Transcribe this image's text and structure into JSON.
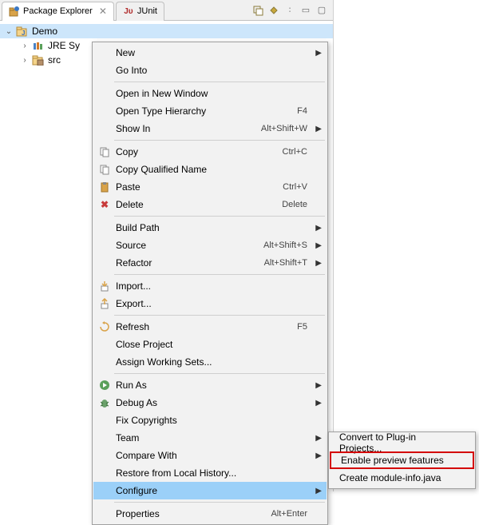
{
  "tabs": {
    "active": {
      "label": "Package Explorer"
    },
    "inactive": {
      "label": "JUnit"
    }
  },
  "tree": {
    "project": "Demo",
    "jre": "JRE Sy",
    "src": "src"
  },
  "menu": {
    "new": "New",
    "goInto": "Go Into",
    "openNewWindow": "Open in New Window",
    "openTypeHierarchy": "Open Type Hierarchy",
    "showIn": "Show In",
    "copy": "Copy",
    "copyQualified": "Copy Qualified Name",
    "paste": "Paste",
    "delete": "Delete",
    "buildPath": "Build Path",
    "source": "Source",
    "refactor": "Refactor",
    "import": "Import...",
    "export": "Export...",
    "refresh": "Refresh",
    "closeProject": "Close Project",
    "assignWorkingSets": "Assign Working Sets...",
    "runAs": "Run As",
    "debugAs": "Debug As",
    "fixCopyrights": "Fix Copyrights",
    "team": "Team",
    "compareWith": "Compare With",
    "restoreLocal": "Restore from Local History...",
    "configure": "Configure",
    "properties": "Properties"
  },
  "shortcuts": {
    "f4": "F4",
    "altShiftW": "Alt+Shift+W",
    "ctrlC": "Ctrl+C",
    "ctrlV": "Ctrl+V",
    "delete": "Delete",
    "altShiftS": "Alt+Shift+S",
    "altShiftT": "Alt+Shift+T",
    "f5": "F5",
    "altEnter": "Alt+Enter"
  },
  "submenu": {
    "convertPlugin": "Convert to Plug-in Projects...",
    "enablePreview": "Enable preview features",
    "createModuleInfo": "Create module-info.java"
  }
}
